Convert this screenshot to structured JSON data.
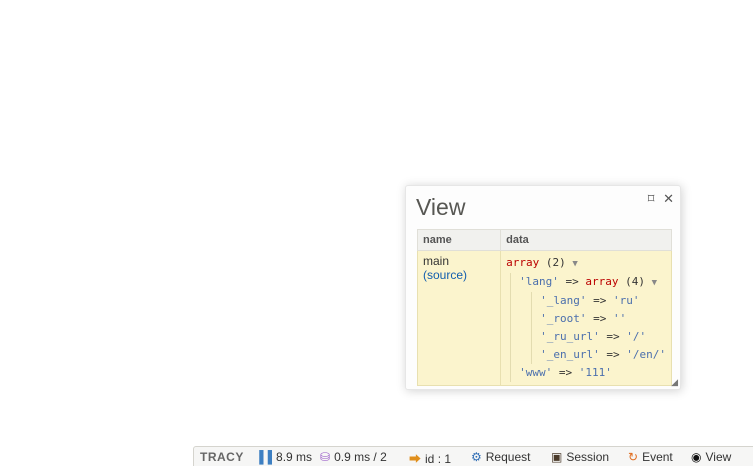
{
  "panel": {
    "title": "View",
    "pin_icon": "pin-icon",
    "close_icon": "close-icon",
    "columns": [
      "name",
      "data"
    ],
    "row": {
      "name": "main",
      "source_label": "(source)"
    },
    "dump": {
      "root_type": "array",
      "root_count": "(2)",
      "lang_key": "'lang'",
      "arrow": "=>",
      "lang_type": "array",
      "lang_count": "(4)",
      "entries": [
        {
          "key": "'_lang'",
          "value": "'ru'"
        },
        {
          "key": "'_root'",
          "value": "''"
        },
        {
          "key": "'_ru_url'",
          "value": "'/'"
        },
        {
          "key": "'_en_url'",
          "value": "'/en/'"
        }
      ],
      "www_key": "'www'",
      "www_value": "'111'"
    }
  },
  "tracy_bar": {
    "logo": "TRACY",
    "time": "8.9 ms",
    "db": "0.9 ms / 2",
    "id": "id : 1",
    "request": "Request",
    "session": "Session",
    "event": "Event",
    "view": "View"
  }
}
